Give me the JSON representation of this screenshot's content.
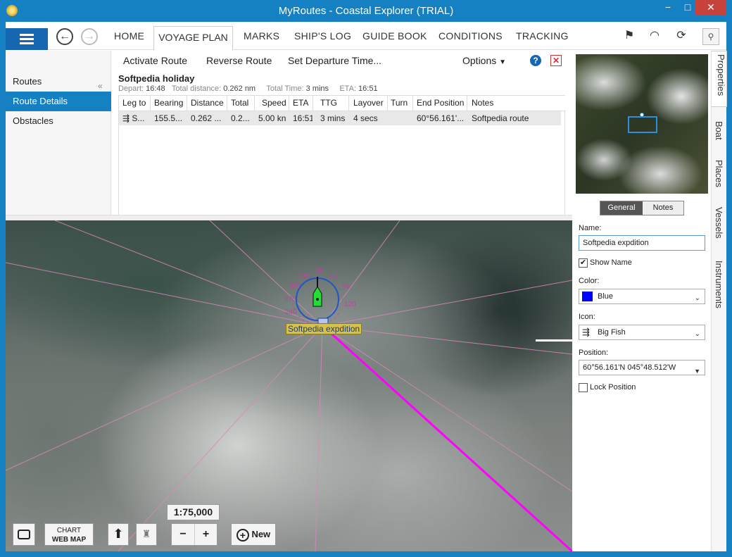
{
  "window": {
    "title": "MyRoutes - Coastal Explorer (TRIAL)",
    "min_glyph": "−",
    "max_glyph": "□",
    "close_glyph": "✕"
  },
  "menu": {
    "tabs": [
      "HOME",
      "VOYAGE PLAN",
      "MARKS",
      "SHIP'S LOG",
      "GUIDE BOOK",
      "CONDITIONS",
      "TRACKING"
    ],
    "active_tab": "VOYAGE PLAN"
  },
  "leftnav": {
    "items": [
      "Routes",
      "Route Details",
      "Obstacles"
    ],
    "selected": "Route Details",
    "collapse_glyph": "«"
  },
  "toolbar": {
    "activate": "Activate Route",
    "reverse": "Reverse Route",
    "set_departure": "Set Departure Time...",
    "options": "Options"
  },
  "route": {
    "name": "Softpedia holiday",
    "depart_label": "Depart:",
    "depart": "16:48",
    "distance_label": "Total distance:",
    "distance": "0.262 nm",
    "time_label": "Total Time:",
    "time": "3 mins",
    "eta_label": "ETA:",
    "eta": "16:51"
  },
  "table": {
    "headers": [
      "Leg to",
      "Bearing",
      "Distance",
      "Total",
      "Speed",
      "ETA",
      "TTG",
      "Layover",
      "Turn",
      "End Position",
      "Notes"
    ],
    "row": [
      "S...",
      "155.5...",
      "0.262 ...",
      "0.2...",
      "5.00 kn",
      "16:51",
      "3 mins",
      "4 secs",
      "",
      "60°56.161'...",
      "Softpedia route"
    ]
  },
  "map": {
    "scale": "1:75,000",
    "chart_label": "CHART",
    "webmap_label": "WEB MAP",
    "new_label": "New",
    "minus_label": "−",
    "plus_label": "+",
    "mark_name": "Softpedia expdition",
    "compass_ticks": [
      "30",
      "60",
      "90",
      "120",
      "300",
      "330",
      "270",
      "240"
    ]
  },
  "props": {
    "tab_general": "General",
    "tab_notes": "Notes",
    "name_label": "Name:",
    "name_value": "Softpedia expdition",
    "show_name_label": "Show Name",
    "show_name_checked": "✔",
    "color_label": "Color:",
    "color_value": "Blue",
    "color_hex": "#0000ff",
    "icon_label": "Icon:",
    "icon_value": "Big Fish",
    "position_label": "Position:",
    "position_value": "60°56.161'N  045°48.512'W",
    "lock_label": "Lock Position"
  },
  "sidetabs": [
    "Properties",
    "Boat",
    "Places",
    "Vessels",
    "Instruments"
  ]
}
